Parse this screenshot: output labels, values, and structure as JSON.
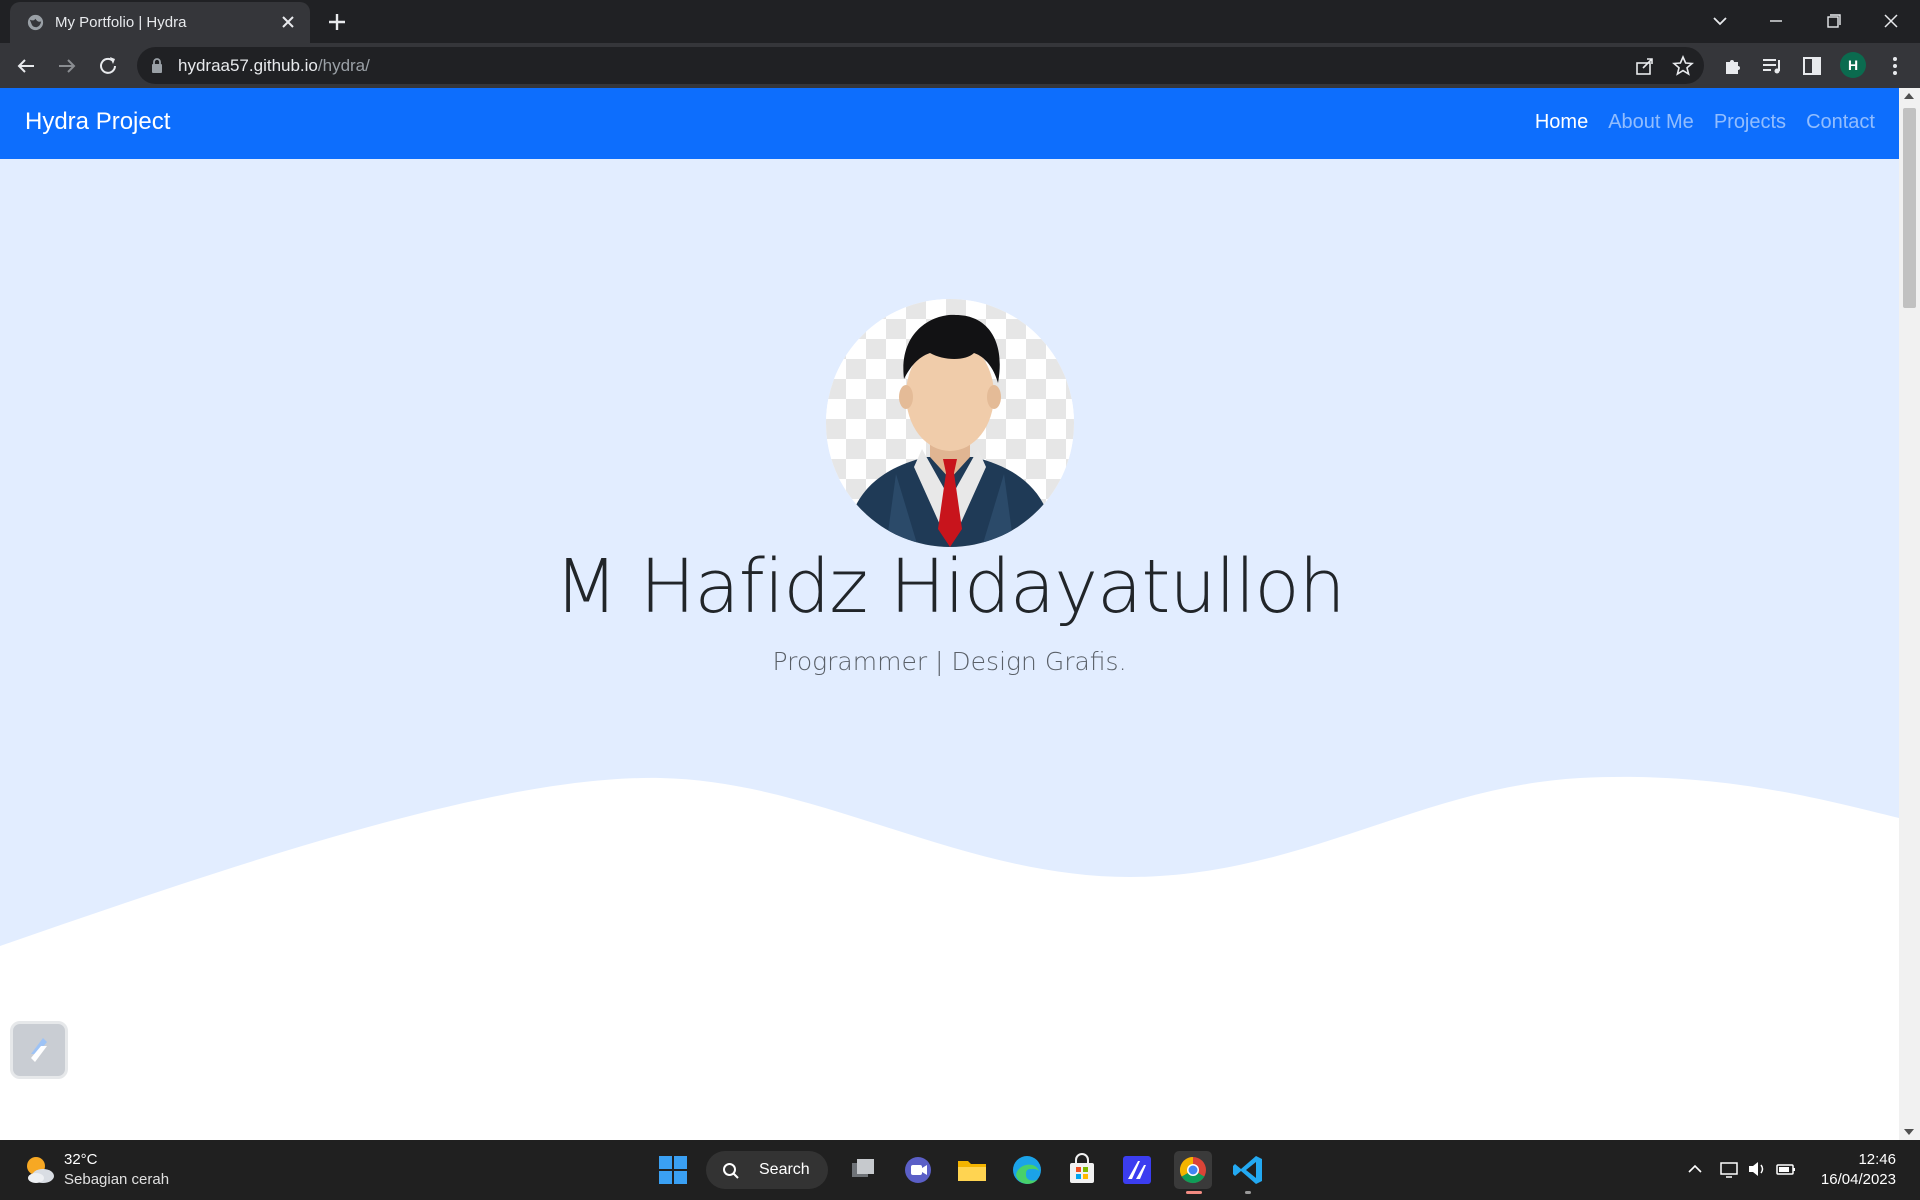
{
  "browser": {
    "tab_title": "My Portfolio | Hydra",
    "url_host": "hydraa57.github.io",
    "url_path": "/hydra/",
    "profile_initial": "H"
  },
  "navbar": {
    "brand": "Hydra Project",
    "links": [
      {
        "label": "Home",
        "active": true
      },
      {
        "label": "About Me",
        "active": false
      },
      {
        "label": "Projects",
        "active": false
      },
      {
        "label": "Contact",
        "active": false
      }
    ]
  },
  "hero": {
    "name": "M Hafidz Hidayatulloh",
    "role": "Programmer | Design Grafis."
  },
  "taskbar": {
    "weather_temp": "32°C",
    "weather_desc": "Sebagian cerah",
    "search_label": "Search",
    "time": "12:46",
    "date": "16/04/2023",
    "apps": [
      "start-icon",
      "task-view-icon",
      "chat-icon",
      "file-explorer-icon",
      "edge-icon",
      "store-icon",
      "app-icon",
      "chrome-icon",
      "vscode-icon"
    ]
  },
  "colors": {
    "navbar": "#0d6efd",
    "hero_bg": "#e2edff",
    "chrome_dark": "#35363a"
  }
}
